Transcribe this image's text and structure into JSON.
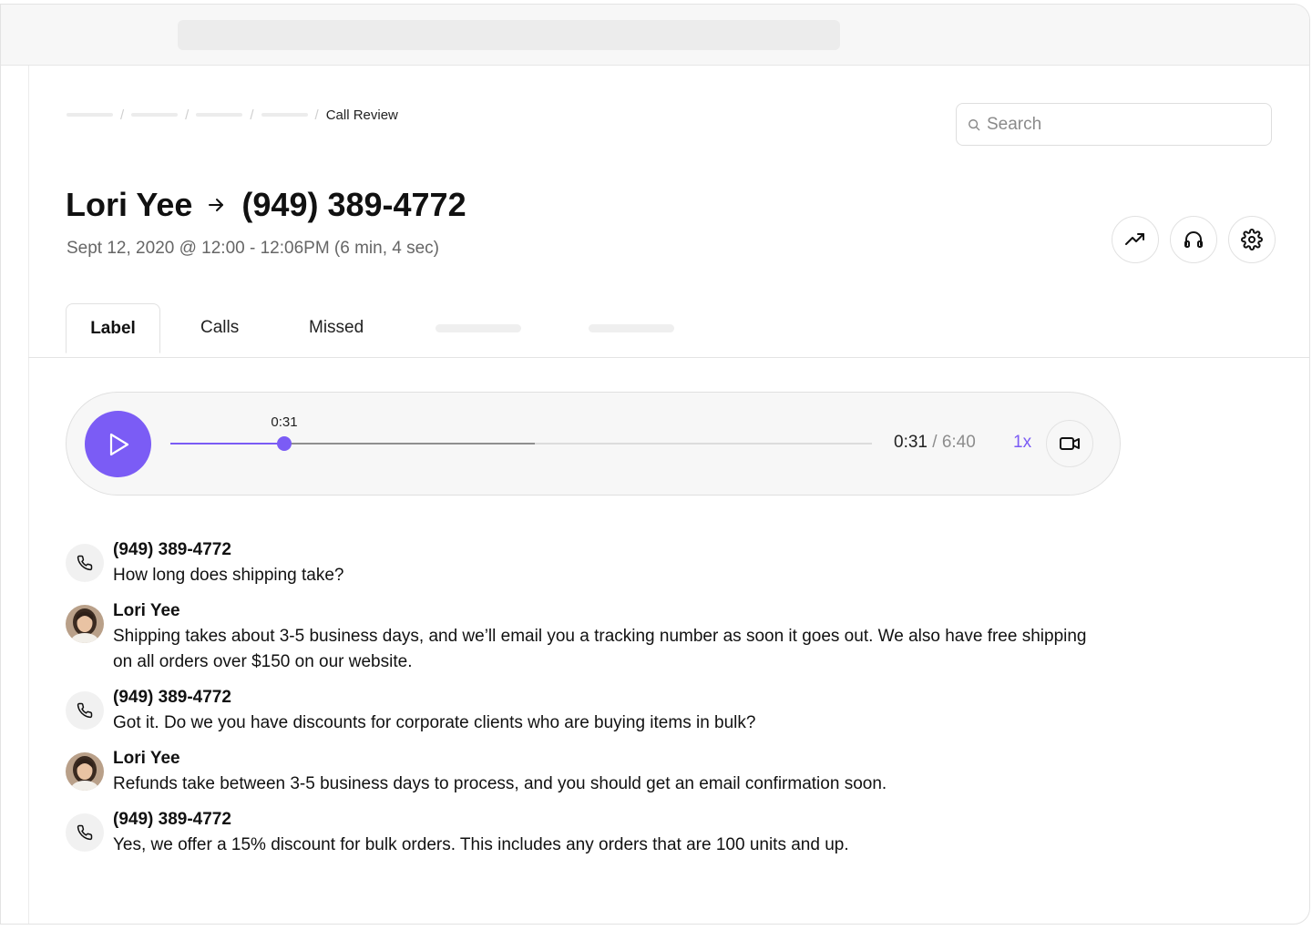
{
  "breadcrumb": {
    "current": "Call Review",
    "separator": "/"
  },
  "search": {
    "placeholder": "Search"
  },
  "header": {
    "caller": "Lori Yee",
    "callee": "(949) 389-4772",
    "subtitle": "Sept 12, 2020 @ 12:00 - 12:06PM (6 min, 4 sec)",
    "actions": [
      "trending-up-icon",
      "headphones-icon",
      "settings-gear-icon"
    ]
  },
  "tabs": [
    {
      "label": "Label",
      "active": true
    },
    {
      "label": "Calls",
      "active": false
    },
    {
      "label": "Missed",
      "active": false
    }
  ],
  "player": {
    "position_label": "0:31",
    "current_time": "0:31",
    "separator": "/",
    "total_time": "6:40",
    "speed": "1x",
    "progress_fraction": 0.162,
    "buffered_fraction": 0.52,
    "accent_color": "#7b5cf5"
  },
  "transcript": [
    {
      "speaker": "(949) 389-4772",
      "type": "phone",
      "text": "How long does shipping take?"
    },
    {
      "speaker": "Lori Yee",
      "type": "agent",
      "text": "Shipping takes about 3-5 business days, and we’ll email you a tracking number as soon it goes out. We also have free shipping on all orders over $150 on our website."
    },
    {
      "speaker": "(949) 389-4772",
      "type": "phone",
      "text": "Got it. Do we you have discounts for corporate clients who are buying items in bulk?"
    },
    {
      "speaker": "Lori Yee",
      "type": "agent",
      "text": "Refunds take between 3-5 business days to process, and you should get an email confirmation soon."
    },
    {
      "speaker": "(949) 389-4772",
      "type": "phone",
      "text": "Yes, we offer a 15% discount for bulk orders. This includes any orders that are 100 units and up."
    }
  ]
}
